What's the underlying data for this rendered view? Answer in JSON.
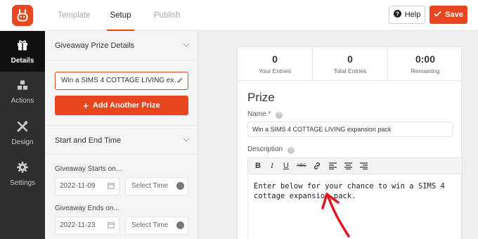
{
  "brand": {
    "logo_color": "#e8461e"
  },
  "header": {
    "tabs": [
      {
        "label": "Template",
        "active": false
      },
      {
        "label": "Setup",
        "active": true
      },
      {
        "label": "Publish",
        "active": false
      }
    ],
    "help_label": "Help",
    "save_label": "Save"
  },
  "leftnav": {
    "items": [
      {
        "label": "Details",
        "icon": "gift-icon",
        "active": true
      },
      {
        "label": "Actions",
        "icon": "cubes-icon",
        "active": false
      },
      {
        "label": "Design",
        "icon": "design-tools-icon",
        "active": false
      },
      {
        "label": "Settings",
        "icon": "gear-icon",
        "active": false
      }
    ]
  },
  "panel": {
    "prize_section_title": "Giveaway Prize Details",
    "prize_value": "Win a SIMS 4 COTTAGE LIVING ex…",
    "add_prize_label": "Add Another Prize",
    "time_section_title": "Start and End Time",
    "starts_label": "Giveaway Starts on...",
    "start_date": "2022-11-09",
    "start_time_placeholder": "Select Time",
    "ends_label": "Giveaway Ends on...",
    "end_date": "2022-11-23",
    "end_time_placeholder": "Select Time"
  },
  "preview": {
    "stats": [
      {
        "value": "0",
        "label": "Your Entries"
      },
      {
        "value": "0",
        "label": "Total Entries"
      },
      {
        "value": "0:00",
        "label": "Remaining"
      }
    ],
    "prize_heading": "Prize",
    "name_label": "Name",
    "required_mark": "*",
    "name_value": "Win a SIMS 4 COTTAGE LIVING expansion pack",
    "description_label": "Description",
    "toolbar": [
      "B",
      "I",
      "U",
      "ABC",
      "link",
      "align-left",
      "align-center",
      "align-right"
    ],
    "description_text": "Enter below for your chance to win a SIMS 4 cottage expansion pack.",
    "annotation_color": "#e0141a"
  }
}
